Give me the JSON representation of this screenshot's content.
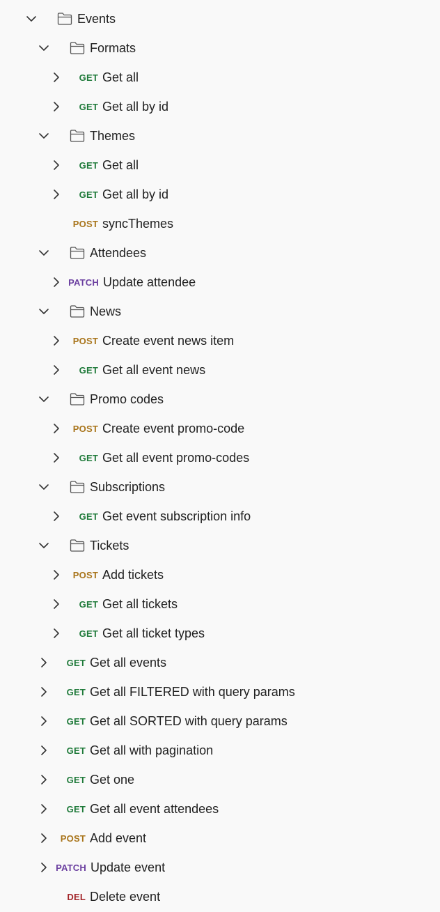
{
  "colors": {
    "get": "#1f7a3a",
    "post": "#a8741a",
    "patch": "#6b3fa0",
    "del": "#a3262a",
    "background": "#f9f9f9",
    "text": "#212121"
  },
  "icons": {
    "expanded": "chevron-down-icon",
    "collapsed": "chevron-right-icon",
    "folder": "folder-icon"
  },
  "tree": {
    "events": {
      "label": "Events",
      "expanded": true
    },
    "formats": {
      "label": "Formats",
      "items": [
        {
          "method": "GET",
          "label": "Get all"
        },
        {
          "method": "GET",
          "label": "Get all by id"
        }
      ]
    },
    "themes": {
      "label": "Themes",
      "items": [
        {
          "method": "GET",
          "label": "Get all"
        },
        {
          "method": "GET",
          "label": "Get all by id"
        },
        {
          "method": "POST",
          "label": "syncThemes"
        }
      ]
    },
    "attendees": {
      "label": "Attendees",
      "items": [
        {
          "method": "PATCH",
          "label": "Update attendee"
        }
      ]
    },
    "news": {
      "label": "News",
      "items": [
        {
          "method": "POST",
          "label": "Create event news item"
        },
        {
          "method": "GET",
          "label": "Get all event news"
        }
      ]
    },
    "promo": {
      "label": "Promo codes",
      "items": [
        {
          "method": "POST",
          "label": "Create event promo-code"
        },
        {
          "method": "GET",
          "label": "Get all event promo-codes"
        }
      ]
    },
    "subscriptions": {
      "label": "Subscriptions",
      "items": [
        {
          "method": "GET",
          "label": "Get event subscription info"
        }
      ]
    },
    "tickets": {
      "label": "Tickets",
      "items": [
        {
          "method": "POST",
          "label": "Add tickets"
        },
        {
          "method": "GET",
          "label": "Get all tickets"
        },
        {
          "method": "GET",
          "label": "Get all ticket types"
        }
      ]
    },
    "requests": [
      {
        "method": "GET",
        "label": "Get all events"
      },
      {
        "method": "GET",
        "label": "Get all FILTERED with query params"
      },
      {
        "method": "GET",
        "label": "Get all SORTED with query params"
      },
      {
        "method": "GET",
        "label": "Get all with pagination"
      },
      {
        "method": "GET",
        "label": "Get one"
      },
      {
        "method": "GET",
        "label": "Get all event attendees"
      },
      {
        "method": "POST",
        "label": "Add event"
      },
      {
        "method": "PATCH",
        "label": "Update event"
      },
      {
        "method": "DEL",
        "label": "Delete event"
      }
    ]
  }
}
